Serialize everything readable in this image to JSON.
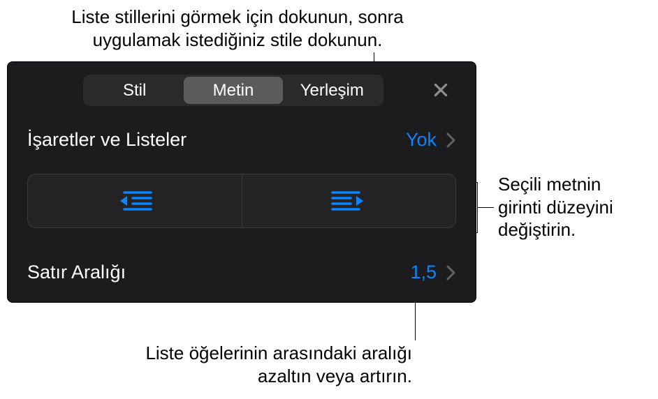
{
  "callouts": {
    "top": {
      "line1": "Liste stillerini görmek için dokunun, sonra",
      "line2": "uygulamak istediğiniz stile dokunun."
    },
    "right": {
      "line1": "Seçili metnin",
      "line2": "girinti düzeyini",
      "line3": "değiştirin."
    },
    "bottom": {
      "line1": "Liste öğelerinin arasındaki aralığı",
      "line2": "azaltın veya artırın."
    }
  },
  "panel": {
    "tabs": {
      "style": "Stil",
      "text": "Metin",
      "layout": "Yerleşim"
    },
    "bulletsLists": {
      "label": "İşaretler ve Listeler",
      "value": "Yok"
    },
    "lineSpacing": {
      "label": "Satır Aralığı",
      "value": "1,5"
    }
  }
}
